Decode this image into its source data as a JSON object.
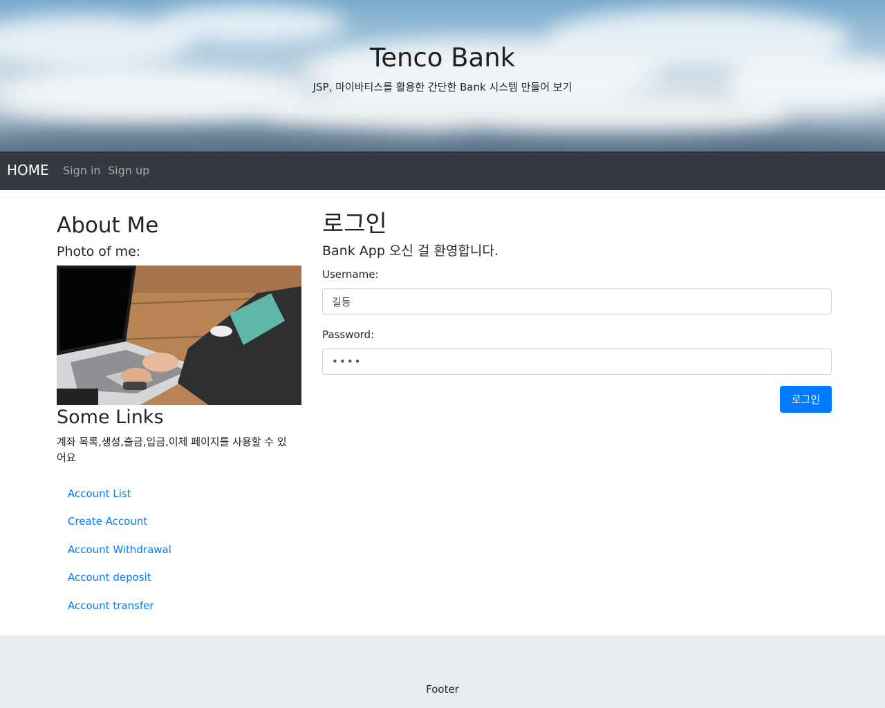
{
  "header": {
    "title": "Tenco Bank",
    "subtitle": "JSP, 마이바티스를 활용한 간단한 Bank 시스템 만들어 보기"
  },
  "navbar": {
    "brand": "HOME",
    "links": [
      {
        "label": "Sign in"
      },
      {
        "label": "Sign up"
      }
    ],
    "bg_color": "#343a40"
  },
  "sidebar": {
    "about_title": "About Me",
    "photo_label": "Photo of me:",
    "photo_icon": "laptop-photo",
    "links_title": "Some Links",
    "links_description": "계좌 목록,생성,출금,입금,이체 페이지를 사용할 수 있어요",
    "links": [
      {
        "label": "Account List"
      },
      {
        "label": "Create Account"
      },
      {
        "label": "Account Withdrawal"
      },
      {
        "label": "Account deposit"
      },
      {
        "label": "Account transfer"
      }
    ],
    "link_color": "#007bff"
  },
  "login": {
    "title": "로그인",
    "welcome": "Bank App 오신 걸 환영합니다.",
    "username_label": "Username:",
    "username_value": "길동",
    "password_label": "Password:",
    "password_value": "1234",
    "submit_label": "로그인",
    "button_color": "#007bff"
  },
  "footer": {
    "text": "Footer"
  }
}
